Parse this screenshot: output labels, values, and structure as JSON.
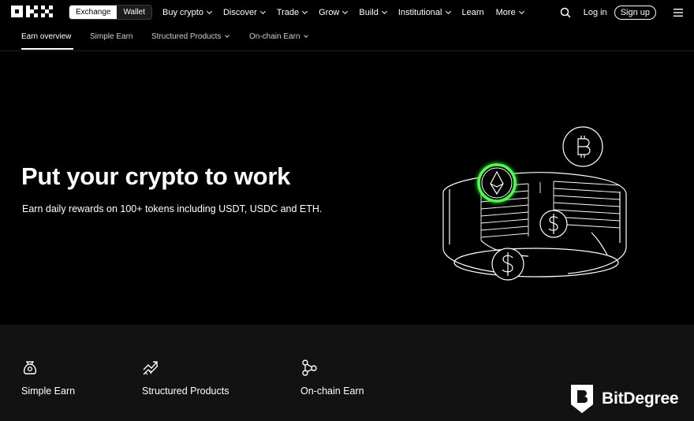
{
  "brand": {
    "logo_text": "OKX"
  },
  "header": {
    "segment": [
      {
        "label": "Exchange",
        "active": true
      },
      {
        "label": "Wallet",
        "active": false
      }
    ],
    "nav": [
      {
        "label": "Buy crypto",
        "dropdown": true
      },
      {
        "label": "Discover",
        "dropdown": true
      },
      {
        "label": "Trade",
        "dropdown": true
      },
      {
        "label": "Grow",
        "dropdown": true
      },
      {
        "label": "Build",
        "dropdown": true
      },
      {
        "label": "Institutional",
        "dropdown": true
      },
      {
        "label": "Learn",
        "dropdown": false
      },
      {
        "label": "More",
        "dropdown": true
      }
    ],
    "login_label": "Log in",
    "signup_label": "Sign up",
    "icons": [
      "search-icon",
      "menu-icon"
    ]
  },
  "subnav": {
    "items": [
      {
        "label": "Earn overview",
        "active": true,
        "dropdown": false
      },
      {
        "label": "Simple Earn",
        "active": false,
        "dropdown": false
      },
      {
        "label": "Structured Products",
        "active": false,
        "dropdown": true
      },
      {
        "label": "On-chain Earn",
        "active": false,
        "dropdown": true
      }
    ]
  },
  "hero": {
    "title": "Put your crypto to work",
    "subtitle": "Earn daily rewards on 100+ tokens including USDT, USDC and ETH.",
    "illustration_icons": [
      "ethereum-icon",
      "bitcoin-icon",
      "dollar-coin-icon"
    ],
    "accent_color": "#4cff4c"
  },
  "features": [
    {
      "label": "Simple Earn",
      "icon": "money-bag-icon"
    },
    {
      "label": "Structured Products",
      "icon": "chart-trend-icon"
    },
    {
      "label": "On-chain Earn",
      "icon": "nodes-icon"
    }
  ],
  "watermark": {
    "text": "BitDegree"
  },
  "colors": {
    "background": "#000000",
    "band": "#121212",
    "text": "#ffffff"
  }
}
